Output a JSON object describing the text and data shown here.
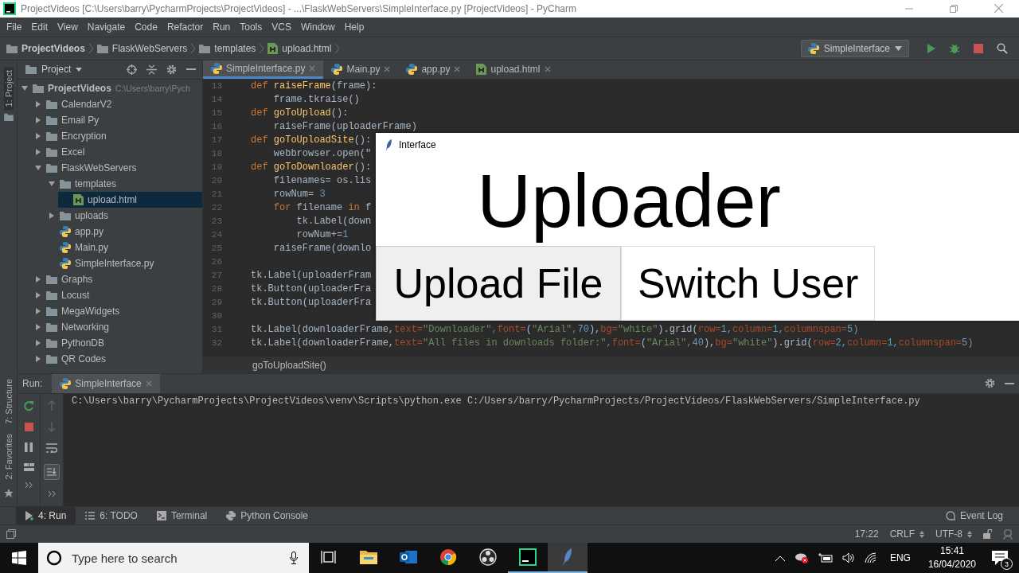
{
  "title_bar": {
    "title": "ProjectVideos [C:\\Users\\barry\\PycharmProjects\\ProjectVideos] - ...\\FlaskWebServers\\SimpleInterface.py [ProjectVideos] - PyCharm"
  },
  "menu": [
    "File",
    "Edit",
    "View",
    "Navigate",
    "Code",
    "Refactor",
    "Run",
    "Tools",
    "VCS",
    "Window",
    "Help"
  ],
  "breadcrumbs": [
    {
      "label": "ProjectVideos",
      "kind": "project"
    },
    {
      "label": "FlaskWebServers",
      "kind": "folder"
    },
    {
      "label": "templates",
      "kind": "folder"
    },
    {
      "label": "upload.html",
      "kind": "html"
    }
  ],
  "run_config": "SimpleInterface",
  "side_stripe": {
    "top": [
      {
        "label": "1: Project",
        "selected": true
      }
    ],
    "bottom": [
      {
        "label": "7: Structure",
        "selected": false
      },
      {
        "label": "2: Favorites",
        "selected": false
      }
    ]
  },
  "project_panel": {
    "title": "Project",
    "tree": [
      {
        "label": "ProjectVideos",
        "path": "C:\\Users\\barry\\Pych",
        "kind": "folder",
        "expanded": true,
        "selected": false,
        "children": [
          {
            "label": "CalendarV2",
            "kind": "folder",
            "expanded": false,
            "selected": false
          },
          {
            "label": "Email Py",
            "kind": "folder",
            "expanded": false,
            "selected": false
          },
          {
            "label": "Encryption",
            "kind": "folder",
            "expanded": false,
            "selected": false
          },
          {
            "label": "Excel",
            "kind": "folder",
            "expanded": false,
            "selected": false
          },
          {
            "label": "FlaskWebServers",
            "kind": "folder",
            "expanded": true,
            "selected": false,
            "children": [
              {
                "label": "templates",
                "kind": "folder",
                "expanded": true,
                "selected": false,
                "children": [
                  {
                    "label": "upload.html",
                    "kind": "html",
                    "selected": true
                  }
                ]
              },
              {
                "label": "uploads",
                "kind": "folder",
                "expanded": false,
                "selected": false
              },
              {
                "label": "app.py",
                "kind": "python",
                "selected": false
              },
              {
                "label": "Main.py",
                "kind": "python",
                "selected": false
              },
              {
                "label": "SimpleInterface.py",
                "kind": "python",
                "selected": false
              }
            ]
          },
          {
            "label": "Graphs",
            "kind": "folder",
            "expanded": false,
            "selected": false
          },
          {
            "label": "Locust",
            "kind": "folder",
            "expanded": false,
            "selected": false
          },
          {
            "label": "MegaWidgets",
            "kind": "folder",
            "expanded": false,
            "selected": false
          },
          {
            "label": "Networking",
            "kind": "folder",
            "expanded": false,
            "selected": false
          },
          {
            "label": "PythonDB",
            "kind": "folder",
            "expanded": false,
            "selected": false
          },
          {
            "label": "QR Codes",
            "kind": "folder",
            "expanded": false,
            "selected": false
          }
        ]
      }
    ]
  },
  "editor": {
    "tabs": [
      {
        "label": "SimpleInterface.py",
        "kind": "python",
        "selected": true
      },
      {
        "label": "Main.py",
        "kind": "python",
        "selected": false
      },
      {
        "label": "app.py",
        "kind": "python",
        "selected": false
      },
      {
        "label": "upload.html",
        "kind": "html",
        "selected": false
      }
    ],
    "lines": [
      {
        "number": "13",
        "tokens": [
          {
            "t": "def ",
            "color": "#cc7832"
          },
          {
            "t": "raiseFrame",
            "color": "#ffc66d"
          },
          {
            "t": "(frame):",
            "color": "#a9b7c6"
          }
        ]
      },
      {
        "number": "14",
        "tokens": [
          {
            "t": "    frame.tkraise()",
            "color": "#a9b7c6"
          }
        ]
      },
      {
        "number": "15",
        "tokens": [
          {
            "t": "def ",
            "color": "#cc7832"
          },
          {
            "t": "goToUpload",
            "color": "#ffc66d"
          },
          {
            "t": "():",
            "color": "#a9b7c6"
          }
        ]
      },
      {
        "number": "16",
        "tokens": [
          {
            "t": "    raiseFrame(uploaderFrame)",
            "color": "#a9b7c6"
          }
        ]
      },
      {
        "number": "17",
        "tokens": [
          {
            "t": "def ",
            "color": "#cc7832"
          },
          {
            "t": "goToUploadSite",
            "color": "#ffc66d"
          },
          {
            "t": "():",
            "color": "#a9b7c6"
          }
        ]
      },
      {
        "number": "18",
        "tokens": [
          {
            "t": "    webbrowser.open(\"",
            "color": "#a9b7c6"
          }
        ]
      },
      {
        "number": "19",
        "tokens": [
          {
            "t": "def ",
            "color": "#cc7832"
          },
          {
            "t": "goToDownloader",
            "color": "#ffc66d"
          },
          {
            "t": "():",
            "color": "#a9b7c6"
          }
        ]
      },
      {
        "number": "20",
        "tokens": [
          {
            "t": "    filenames= os.lis",
            "color": "#a9b7c6"
          }
        ]
      },
      {
        "number": "21",
        "tokens": [
          {
            "t": "    rowNum= ",
            "color": "#a9b7c6"
          },
          {
            "t": "3",
            "color": "#6897bb"
          }
        ]
      },
      {
        "number": "22",
        "tokens": [
          {
            "t": "    for ",
            "color": "#cc7832"
          },
          {
            "t": "filename ",
            "color": "#a9b7c6"
          },
          {
            "t": "in ",
            "color": "#cc7832"
          },
          {
            "t": "f",
            "color": "#a9b7c6"
          }
        ]
      },
      {
        "number": "23",
        "tokens": [
          {
            "t": "        tk.Label(down",
            "color": "#a9b7c6"
          }
        ]
      },
      {
        "number": "24",
        "tokens": [
          {
            "t": "        rowNum+=",
            "color": "#a9b7c6"
          },
          {
            "t": "1",
            "color": "#6897bb"
          }
        ]
      },
      {
        "number": "25",
        "tokens": [
          {
            "t": "    raiseFrame(downlo",
            "color": "#a9b7c6"
          }
        ]
      },
      {
        "number": "26"
      },
      {
        "number": "27",
        "tokens": [
          {
            "t": "tk.Label(uploaderFram",
            "color": "#a9b7c6"
          }
        ]
      },
      {
        "number": "28",
        "tokens": [
          {
            "t": "tk.Button(uploaderFra",
            "color": "#a9b7c6"
          }
        ]
      },
      {
        "number": "29",
        "tokens": [
          {
            "t": "tk.Button(uploaderFra",
            "color": "#a9b7c6"
          }
        ]
      },
      {
        "number": "30"
      },
      {
        "number": "31",
        "tokens": [
          {
            "t": "tk.Label(downloaderFrame,",
            "color": "#a9b7c6"
          },
          {
            "t": "text=",
            "color": "#aa4926"
          },
          {
            "t": "\"Downloader\",",
            "color": "#6a8759"
          },
          {
            "t": "font=",
            "color": "#aa4926"
          },
          {
            "t": "(",
            "color": "#a9b7c6"
          },
          {
            "t": "\"Arial\",",
            "color": "#6a8759"
          },
          {
            "t": "70",
            "color": "#6897bb"
          },
          {
            "t": "),",
            "color": "#a9b7c6"
          },
          {
            "t": "bg=",
            "color": "#aa4926"
          },
          {
            "t": "\"white\"",
            "color": "#6a8759"
          },
          {
            "t": ").grid(",
            "color": "#a9b7c6"
          },
          {
            "t": "row=",
            "color": "#aa4926"
          },
          {
            "t": "1,",
            "color": "#6897bb"
          },
          {
            "t": "column=",
            "color": "#aa4926"
          },
          {
            "t": "1,",
            "color": "#6897bb"
          },
          {
            "t": "columnspan=",
            "color": "#aa4926"
          },
          {
            "t": "5)",
            "color": "#6897bb"
          }
        ]
      },
      {
        "number": "32",
        "tokens": [
          {
            "t": "tk.Label(downloaderFrame,",
            "color": "#a9b7c6"
          },
          {
            "t": "text=",
            "color": "#aa4926"
          },
          {
            "t": "\"All files in downloads folder:\",",
            "color": "#6a8759"
          },
          {
            "t": "font=",
            "color": "#aa4926"
          },
          {
            "t": "(",
            "color": "#a9b7c6"
          },
          {
            "t": "\"Arial\",",
            "color": "#6a8759"
          },
          {
            "t": "40",
            "color": "#6897bb"
          },
          {
            "t": "),",
            "color": "#a9b7c6"
          },
          {
            "t": "bg=",
            "color": "#aa4926"
          },
          {
            "t": "\"white\"",
            "color": "#6a8759"
          },
          {
            "t": ").grid(",
            "color": "#a9b7c6"
          },
          {
            "t": "row=",
            "color": "#aa4926"
          },
          {
            "t": "2,",
            "color": "#6897bb"
          },
          {
            "t": "column=",
            "color": "#aa4926"
          },
          {
            "t": "1,",
            "color": "#6897bb"
          },
          {
            "t": "columnspan=",
            "color": "#aa4926"
          },
          {
            "t": "5)",
            "color": "#6897bb"
          }
        ]
      }
    ],
    "breadcrumb": "goToUploadSite()"
  },
  "dialog": {
    "title": "Interface",
    "heading": "Uploader",
    "buttons": [
      {
        "label": "Upload File",
        "hovered": true
      },
      {
        "label": "Switch User",
        "hovered": false
      }
    ]
  },
  "run_panel": {
    "label": "Run:",
    "tab": "SimpleInterface",
    "output": [
      "C:\\Users\\barry\\PycharmProjects\\ProjectVideos\\venv\\Scripts\\python.exe C:/Users/barry/PycharmProjects/ProjectVideos/FlaskWebServers/SimpleInterface.py"
    ]
  },
  "tool_tabs": [
    {
      "label": "4: Run",
      "kind": "run",
      "selected": true
    },
    {
      "label": "6: TODO",
      "kind": "todo",
      "selected": false
    },
    {
      "label": "Terminal",
      "kind": "terminal",
      "selected": false
    },
    {
      "label": "Python Console",
      "kind": "console",
      "selected": false
    }
  ],
  "event_log": "Event Log",
  "status": {
    "position": "17:22",
    "line_separator": "CRLF",
    "encoding": "UTF-8"
  },
  "taskbar": {
    "search": {
      "placeholder": "Type here to search"
    },
    "apps": [
      {
        "kind": "task-view",
        "running": false,
        "active": false
      },
      {
        "kind": "explorer",
        "running": false,
        "active": false
      },
      {
        "kind": "outlook",
        "running": false,
        "active": false
      },
      {
        "kind": "chrome",
        "running": false,
        "active": false
      },
      {
        "kind": "obs",
        "running": false,
        "active": false
      },
      {
        "kind": "pycharm",
        "running": true,
        "active": false
      },
      {
        "kind": "feather",
        "running": true,
        "active": true
      }
    ],
    "language": "ENG",
    "time": "15:41",
    "date": "16/04/2020",
    "notifications": "3"
  }
}
